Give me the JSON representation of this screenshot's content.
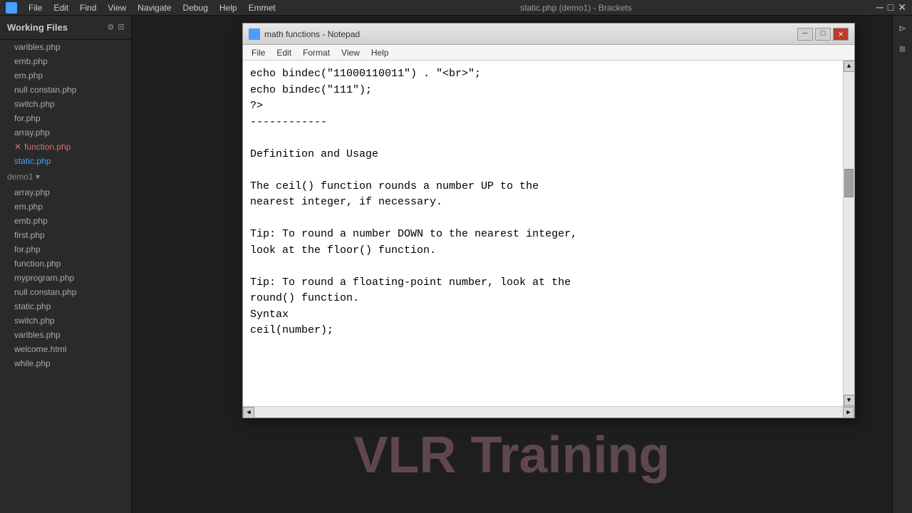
{
  "app": {
    "title": "static.php (demo1) - Brackets",
    "menuItems": [
      "File",
      "Edit",
      "Find",
      "View",
      "Navigate",
      "Debug",
      "Help",
      "Emmet"
    ]
  },
  "sidebar": {
    "title": "Working Files",
    "workingFiles": [
      {
        "name": "varibles.php",
        "state": "normal"
      },
      {
        "name": "emb.php",
        "state": "normal"
      },
      {
        "name": "em.php",
        "state": "normal"
      },
      {
        "name": "null constan.php",
        "state": "normal"
      },
      {
        "name": "switch.php",
        "state": "normal"
      },
      {
        "name": "for.php",
        "state": "normal"
      },
      {
        "name": "array.php",
        "state": "normal"
      },
      {
        "name": "function.php",
        "state": "has-error"
      },
      {
        "name": "static.php",
        "state": "active-blue"
      }
    ],
    "projectSection": "demo1",
    "projectFiles": [
      {
        "name": "array.php",
        "state": "normal"
      },
      {
        "name": "em.php",
        "state": "normal"
      },
      {
        "name": "emb.php",
        "state": "normal"
      },
      {
        "name": "first.php",
        "state": "normal"
      },
      {
        "name": "for.php",
        "state": "normal"
      },
      {
        "name": "function.php",
        "state": "normal"
      },
      {
        "name": "myprogram.php",
        "state": "normal"
      },
      {
        "name": "null constan.php",
        "state": "normal"
      },
      {
        "name": "static.php",
        "state": "normal"
      },
      {
        "name": "switch.php",
        "state": "normal"
      },
      {
        "name": "varibles.php",
        "state": "normal"
      },
      {
        "name": "welcome.html",
        "state": "normal"
      },
      {
        "name": "while.php",
        "state": "normal"
      }
    ]
  },
  "notepad": {
    "title": "math functions - Notepad",
    "menuItems": [
      "File",
      "Edit",
      "Format",
      "View",
      "Help"
    ],
    "content_line1": "echo bindec(\"11000110011\") . \"<br>\";",
    "content_line2": "echo bindec(\"111\");",
    "content_line3": "?>",
    "content_separator": "------------",
    "content_definition_header": "Definition and Usage",
    "content_para1": "The ceil() function rounds a number UP to the\nnearest integer, if necessary.",
    "content_para2": "Tip: To round a number DOWN to the nearest integer,\nlook at the floor() function.",
    "content_para3": "Tip: To round a floating-point number, look at the\nround() function.",
    "content_syntax_header": "Syntax",
    "content_syntax": "ceil(number);"
  },
  "watermark": {
    "text": "VLR Training"
  }
}
